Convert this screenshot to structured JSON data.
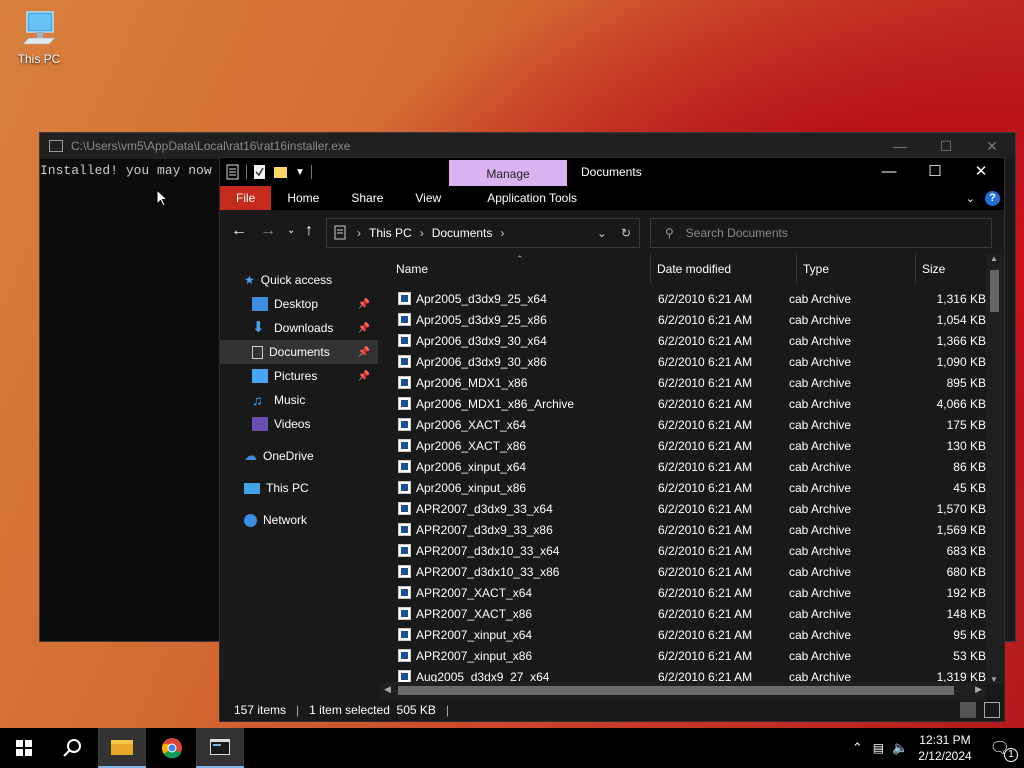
{
  "desktop": {
    "icon_label": "This PC"
  },
  "console": {
    "title": "C:\\Users\\vm5\\AppData\\Local\\rat16\\rat16installer.exe",
    "text": "Installed! you may now"
  },
  "explorer": {
    "title": "Documents",
    "manage_tab": "Manage",
    "ribbon_tabs": [
      "File",
      "Home",
      "Share",
      "View",
      "Application Tools"
    ],
    "breadcrumb": [
      "This PC",
      "Documents"
    ],
    "search_placeholder": "Search Documents",
    "nav": {
      "quick_access": "Quick access",
      "items": [
        "Desktop",
        "Downloads",
        "Documents",
        "Pictures",
        "Music",
        "Videos"
      ],
      "onedrive": "OneDrive",
      "this_pc": "This PC",
      "network": "Network"
    },
    "columns": [
      "Name",
      "Date modified",
      "Type",
      "Size"
    ],
    "files": [
      {
        "name": "Apr2005_d3dx9_25_x64",
        "date": "6/2/2010 6:21 AM",
        "type": "cab Archive",
        "size": "1,316 KB"
      },
      {
        "name": "Apr2005_d3dx9_25_x86",
        "date": "6/2/2010 6:21 AM",
        "type": "cab Archive",
        "size": "1,054 KB"
      },
      {
        "name": "Apr2006_d3dx9_30_x64",
        "date": "6/2/2010 6:21 AM",
        "type": "cab Archive",
        "size": "1,366 KB"
      },
      {
        "name": "Apr2006_d3dx9_30_x86",
        "date": "6/2/2010 6:21 AM",
        "type": "cab Archive",
        "size": "1,090 KB"
      },
      {
        "name": "Apr2006_MDX1_x86",
        "date": "6/2/2010 6:21 AM",
        "type": "cab Archive",
        "size": "895 KB"
      },
      {
        "name": "Apr2006_MDX1_x86_Archive",
        "date": "6/2/2010 6:21 AM",
        "type": "cab Archive",
        "size": "4,066 KB"
      },
      {
        "name": "Apr2006_XACT_x64",
        "date": "6/2/2010 6:21 AM",
        "type": "cab Archive",
        "size": "175 KB"
      },
      {
        "name": "Apr2006_XACT_x86",
        "date": "6/2/2010 6:21 AM",
        "type": "cab Archive",
        "size": "130 KB"
      },
      {
        "name": "Apr2006_xinput_x64",
        "date": "6/2/2010 6:21 AM",
        "type": "cab Archive",
        "size": "86 KB"
      },
      {
        "name": "Apr2006_xinput_x86",
        "date": "6/2/2010 6:21 AM",
        "type": "cab Archive",
        "size": "45 KB"
      },
      {
        "name": "APR2007_d3dx9_33_x64",
        "date": "6/2/2010 6:21 AM",
        "type": "cab Archive",
        "size": "1,570 KB"
      },
      {
        "name": "APR2007_d3dx9_33_x86",
        "date": "6/2/2010 6:21 AM",
        "type": "cab Archive",
        "size": "1,569 KB"
      },
      {
        "name": "APR2007_d3dx10_33_x64",
        "date": "6/2/2010 6:21 AM",
        "type": "cab Archive",
        "size": "683 KB"
      },
      {
        "name": "APR2007_d3dx10_33_x86",
        "date": "6/2/2010 6:21 AM",
        "type": "cab Archive",
        "size": "680 KB"
      },
      {
        "name": "APR2007_XACT_x64",
        "date": "6/2/2010 6:21 AM",
        "type": "cab Archive",
        "size": "192 KB"
      },
      {
        "name": "APR2007_XACT_x86",
        "date": "6/2/2010 6:21 AM",
        "type": "cab Archive",
        "size": "148 KB"
      },
      {
        "name": "APR2007_xinput_x64",
        "date": "6/2/2010 6:21 AM",
        "type": "cab Archive",
        "size": "95 KB"
      },
      {
        "name": "APR2007_xinput_x86",
        "date": "6/2/2010 6:21 AM",
        "type": "cab Archive",
        "size": "53 KB"
      },
      {
        "name": "Aug2005_d3dx9_27_x64",
        "date": "6/2/2010 6:21 AM",
        "type": "cab Archive",
        "size": "1,319 KB"
      }
    ],
    "status": {
      "items": "157 items",
      "selected": "1 item selected  505 KB"
    }
  },
  "taskbar": {
    "time": "12:31 PM",
    "date": "2/12/2024",
    "notification_count": "1"
  },
  "colors": {
    "manage_tab": "#d9b3f2",
    "file_tab": "#c42b1c",
    "accent": "#7fb3e6"
  }
}
